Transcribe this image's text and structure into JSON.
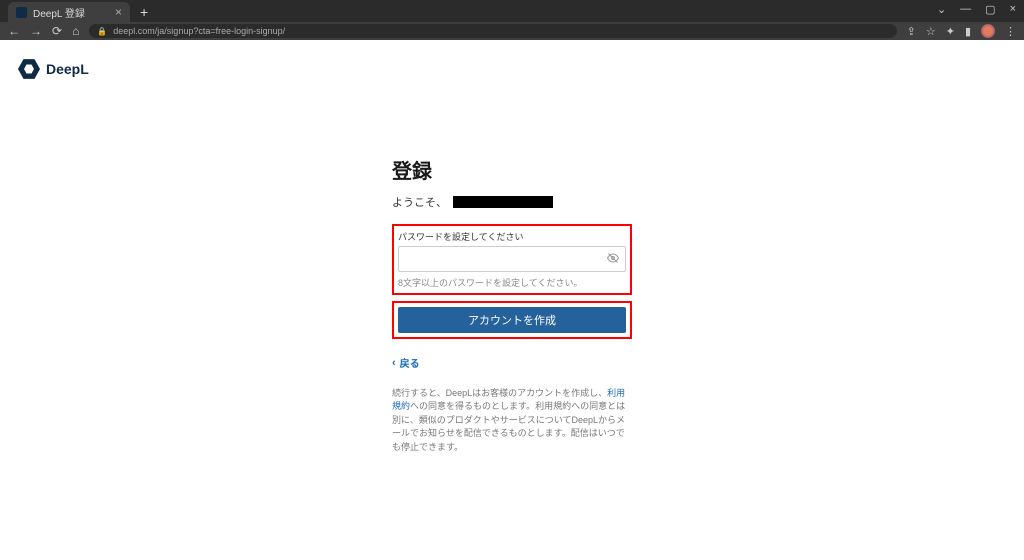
{
  "browser": {
    "tab_title": "DeepL 登録",
    "url": "deepl.com/ja/signup?cta=free-login-signup/"
  },
  "logo": {
    "text": "DeepL"
  },
  "form": {
    "heading": "登録",
    "welcome_prefix": "ようこそ、",
    "password_label": "パスワードを設定してください",
    "password_placeholder": "",
    "password_helper": "8文字以上のパスワードを設定してください。",
    "create_button": "アカウントを作成",
    "back_label": "戻る",
    "terms_text_1": "続行すると、DeepLはお客様のアカウントを作成し、",
    "terms_link": "利用規約",
    "terms_text_2": "への同意を得るものとします。利用規約への同意とは別に、類似のプロダクトやサービスについてDeepLからメールでお知らせを配信できるものとします。配信はいつでも停止できます。"
  }
}
